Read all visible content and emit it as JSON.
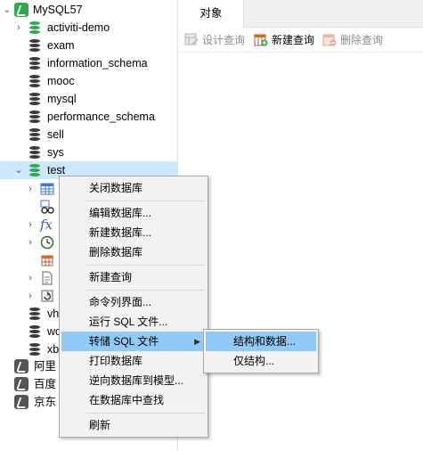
{
  "nav": {
    "connection": "MySQL57",
    "databases": [
      "activiti-demo",
      "exam",
      "information_schema",
      "mooc",
      "mysql",
      "performance_schema",
      "sell",
      "sys",
      "test"
    ],
    "after_menu_dbs": [
      "vh",
      "wo",
      "xb"
    ],
    "other_connections": [
      "阿里",
      "百度",
      "京东"
    ]
  },
  "tab": {
    "label": "对象"
  },
  "toolbar": {
    "design_query": "设计查询",
    "new_query": "新建查询",
    "delete_query": "删除查询"
  },
  "context_menu": {
    "items": [
      "关闭数据库",
      "编辑数据库...",
      "新建数据库...",
      "删除数据库",
      "新建查询",
      "命令列界面...",
      "运行 SQL 文件...",
      "转储 SQL 文件",
      "打印数据库",
      "逆向数据库到模型...",
      "在数据库中查找",
      "刷新"
    ]
  },
  "submenu": {
    "items": [
      "结构和数据...",
      "仅结构..."
    ]
  },
  "colors": {
    "selection": "#cce8ff",
    "menu_highlight": "#91c9f7",
    "db_green": "#2fa84f"
  }
}
